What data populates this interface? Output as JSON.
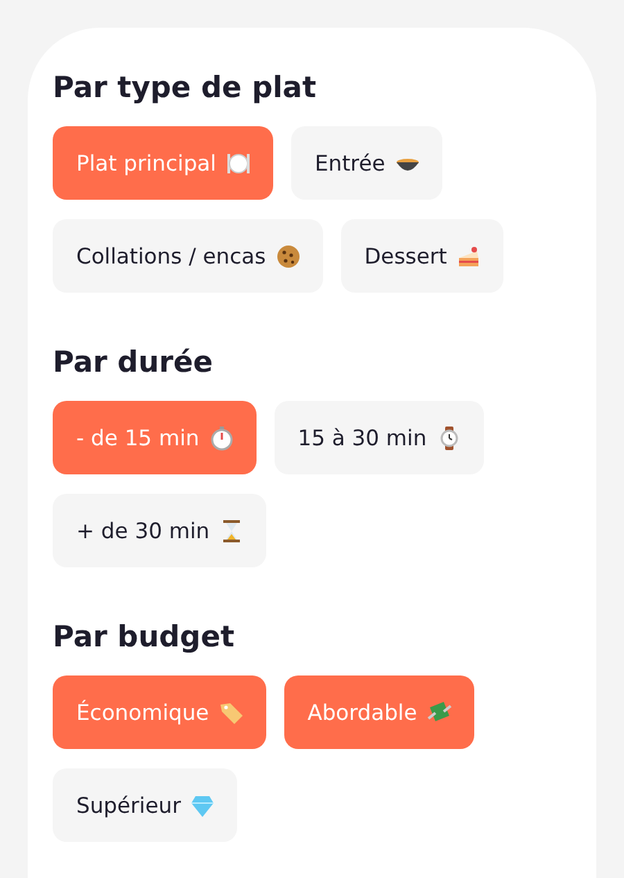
{
  "sections": [
    {
      "title": "Par type de plat",
      "chips": [
        {
          "label": "Plat principal",
          "kind": "plate",
          "selected": true
        },
        {
          "label": "Entrée",
          "kind": "pot",
          "selected": false
        },
        {
          "label": "Collations / encas",
          "kind": "cookie",
          "selected": false
        },
        {
          "label": "Dessert",
          "kind": "cake",
          "selected": false
        }
      ]
    },
    {
      "title": "Par durée",
      "chips": [
        {
          "label": "- de 15 min",
          "kind": "stopwatch",
          "selected": true
        },
        {
          "label": "15 à 30 min",
          "kind": "watch",
          "selected": false
        },
        {
          "label": "+ de 30 min",
          "kind": "hourglass",
          "selected": false
        }
      ]
    },
    {
      "title": "Par budget",
      "chips": [
        {
          "label": "Économique",
          "kind": "tag",
          "selected": true
        },
        {
          "label": "Abordable",
          "kind": "money",
          "selected": true
        },
        {
          "label": "Supérieur",
          "kind": "gem",
          "selected": false
        }
      ]
    }
  ]
}
